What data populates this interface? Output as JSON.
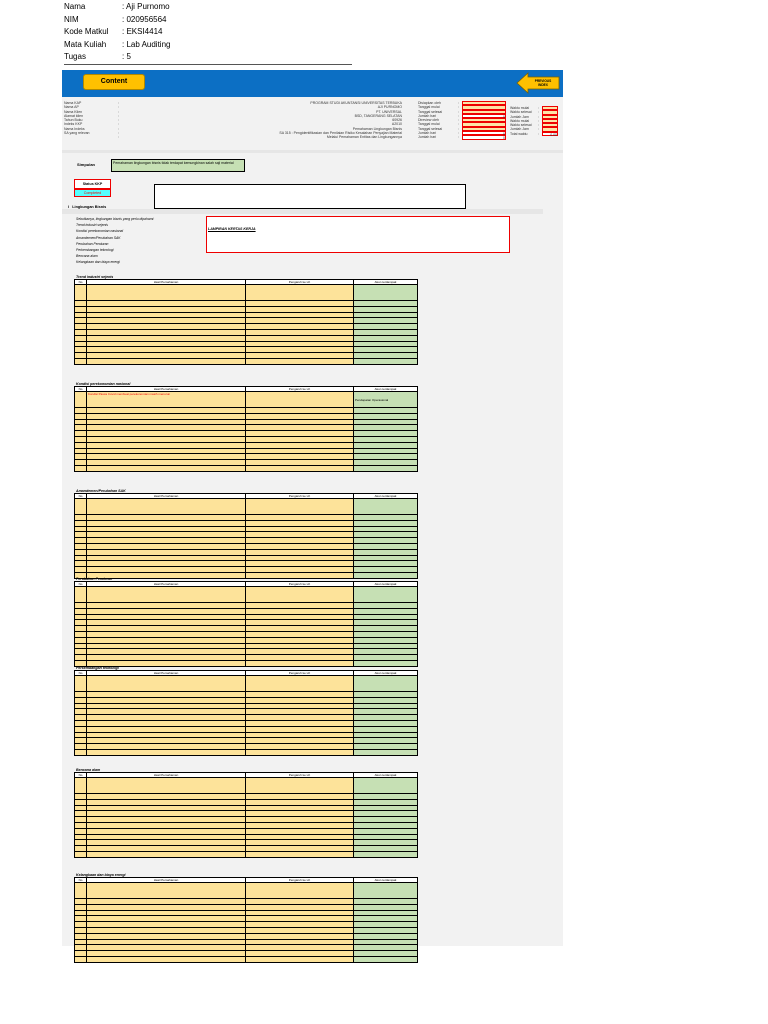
{
  "student": [
    {
      "label": "Nama",
      "value": ": Aji Purnomo"
    },
    {
      "label": "NIM",
      "value": ": 020956564"
    },
    {
      "label": "Kode Matkul",
      "value": ": EKSI4414"
    },
    {
      "label": "Mata Kuliah",
      "value": ": Lab Auditing"
    },
    {
      "label": "Tugas",
      "value": ": 5"
    }
  ],
  "banner": {
    "content_label": "Content",
    "prev_label": "PREVIOUS INDEX"
  },
  "info_left": [
    [
      "Nama KAP",
      "PROGRAM STUDI AKUNTANSI UNIVERSITAS TERBUKA"
    ],
    [
      "Nama AP",
      "AJI PURNOMO"
    ],
    [
      "Nama Klien",
      "PT. UNIVERSAL"
    ],
    [
      "Alamat klien",
      "BSD, TANGERANG SELATAN"
    ],
    [
      "Tahun Buku",
      "60926"
    ],
    [
      "Indeks KKP",
      "A2010"
    ],
    [
      "Nama Indeks",
      "Pemahaman Lingkungan Bisnis"
    ],
    [
      "SA yang relevan",
      "SA 315 : Pengidentifikasian dan Penilaian Risiko Kesalahan Penyajian Material"
    ],
    [
      "",
      "Melalui Pemahaman Entitas dan Lingkungannya"
    ]
  ],
  "info_right": [
    [
      "Disiapkan oleh",
      ""
    ],
    [
      "Tanggal mulai",
      ""
    ],
    [
      "Tanggal selesai",
      ""
    ],
    [
      "Jumlah hari",
      "0"
    ],
    [
      "Direview oleh",
      ""
    ],
    [
      "Tanggal mulai",
      ""
    ],
    [
      "Tanggal selesai",
      ""
    ],
    [
      "Jumlah hari",
      "0"
    ],
    [
      "Jumlah hari",
      "0"
    ]
  ],
  "info_far": [
    [
      "Waktu mulai",
      ""
    ],
    [
      "Waktu selesai",
      ""
    ],
    [
      "Jumlah Jam",
      ""
    ],
    [
      "Waktu mulai",
      ""
    ],
    [
      "Waktu selesai",
      ""
    ],
    [
      "Jumlah Jam",
      ""
    ],
    [
      "Total waktu",
      "0.00"
    ]
  ],
  "simpulan": {
    "label": "Simpulan",
    "text": "Pemahaman lingkungan bisnis tidak terdapat kemungkinan salah saji material"
  },
  "status": {
    "label": "Status KKP",
    "value": "Completed"
  },
  "section": {
    "number": "I",
    "title": "Lingkungan Bisnis"
  },
  "factors": [
    "Sebutkanya, lingkungan bisnis yang perlu dipahami:",
    "Trend industri sejenis",
    "Kondisi perekonomian nasional",
    "Amandemen/Perubahan SAK",
    "Perubahan Peraturan",
    "Perkembangan teknologi",
    "Bencana alam",
    "Kelangkaan dan biaya energi"
  ],
  "lampiran": "LAMPIRAN KERTAS KERJA",
  "columns": [
    "No",
    "Hasil Pemahaman",
    "Pengaruh ke LK",
    "Akun terdampak"
  ],
  "tables": [
    {
      "title": "Trend industri sejenis",
      "first": [
        "",
        "",
        ""
      ]
    },
    {
      "title": "Kondisi perekonomian nasional",
      "first": [
        "Kondisi Pasca Covid membuat perekonomian masih menurun",
        "",
        "Pendapatan Operasional"
      ]
    },
    {
      "title": "Amandemen/Perubahan SAK",
      "first": [
        "",
        "",
        ""
      ]
    },
    {
      "title": "Perubahan Peraturan",
      "first": [
        "",
        "",
        ""
      ]
    },
    {
      "title": "Perkembangan teknologi",
      "first": [
        "",
        "",
        ""
      ]
    },
    {
      "title": "Bencana alam",
      "first": [
        "",
        "",
        ""
      ]
    },
    {
      "title": "Kelangkaan dan biaya energi",
      "first": [
        "",
        "",
        ""
      ]
    }
  ]
}
